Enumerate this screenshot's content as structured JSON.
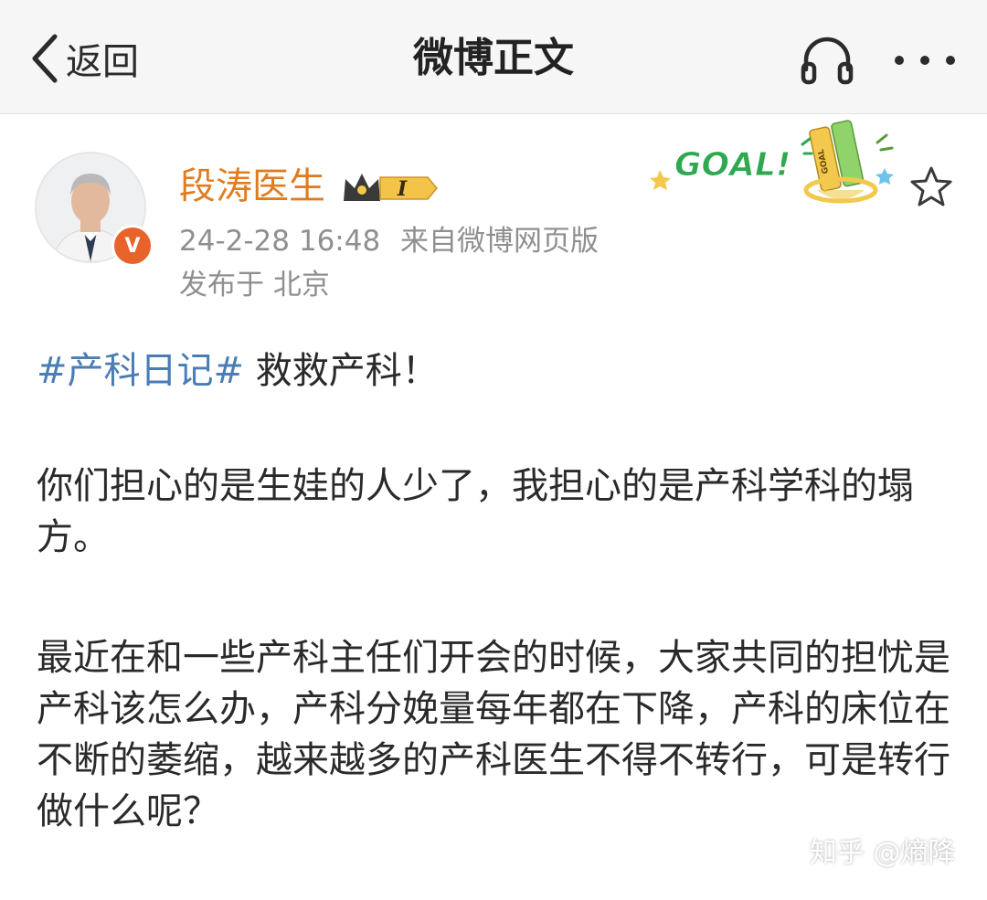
{
  "header": {
    "back_label": "返回",
    "title": "微博正文",
    "icons": {
      "back": "chevron-left-icon",
      "listen": "headphones-icon",
      "more": "more-horizontal-icon"
    }
  },
  "author": {
    "name": "段涛医生",
    "verified_mark": "V",
    "vip_level": "I",
    "timestamp": "24-2-28 16:48",
    "source": "来自微博网页版",
    "location": "发布于 北京",
    "name_color": "#e07c20"
  },
  "sticker": {
    "text": "GOAL!",
    "bottle_text": "GOAL"
  },
  "post": {
    "topic": "#产科日记#",
    "headline": " 救救产科！",
    "paragraph1": "你们担心的是生娃的人少了，我担心的是产科学科的塌方。",
    "paragraph2": "最近在和一些产科主任们开会的时候，大家共同的担忧是产科该怎么办，产科分娩量每年都在下降，产科的床位在不断的萎缩，越来越多的产科医生不得不转行，可是转行做什么呢？",
    "topic_color": "#4a7cb5"
  },
  "watermark": "知乎 @熵降"
}
